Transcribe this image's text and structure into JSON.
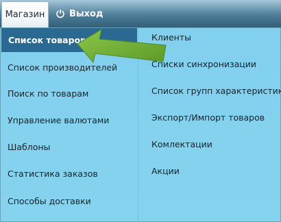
{
  "topbar": {
    "shop_tab": "Магазин",
    "exit_tab": "Выход"
  },
  "menu": {
    "left": [
      "Список товаров",
      "Список производителей",
      "Поиск по товарам",
      "Управление валютами",
      "Шаблоны",
      "Статистика заказов",
      "Способы доставки"
    ],
    "right": [
      "Клиенты",
      "Списки синхронизации",
      "Список групп характеристик",
      "Экспорт/Импорт товаров",
      "Комлектации",
      "Акции"
    ]
  },
  "colors": {
    "active_item": "#2a6a92",
    "panel": "#86d3ef",
    "arrow": "#6aa62f"
  },
  "icons": {
    "exit": "power-icon",
    "annotation": "green-arrow"
  }
}
